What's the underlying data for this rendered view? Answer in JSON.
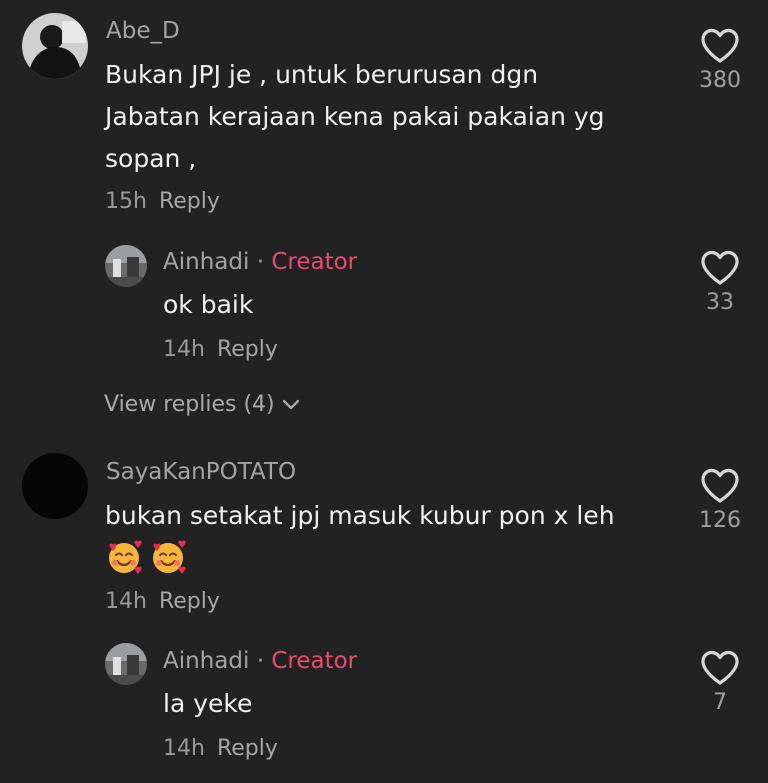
{
  "comments": [
    {
      "username": "Abe_D",
      "text_lines": [
        "Bukan JPJ je , untuk berurusan dgn",
        "Jabatan kerajaan kena pakai pakaian yg",
        "sopan ,"
      ],
      "time": "15h",
      "reply_label": "Reply",
      "likes": "380"
    },
    {
      "username": "Ainhadi",
      "badge": "Creator",
      "separator": "·",
      "text": "ok baik",
      "time": "14h",
      "reply_label": "Reply",
      "likes": "33"
    },
    {
      "username": "SayaKanPOTATO",
      "text": "bukan setakat jpj masuk kubur pon x leh",
      "emojis": [
        "smiling-face-with-hearts",
        "smiling-face-with-hearts"
      ],
      "time": "14h",
      "reply_label": "Reply",
      "likes": "126"
    },
    {
      "username": "Ainhadi",
      "badge": "Creator",
      "separator": "·",
      "text": "la yeke",
      "time": "14h",
      "reply_label": "Reply",
      "likes": "7"
    }
  ],
  "view_replies": "View replies (4)",
  "colors": {
    "background": "#222222",
    "text": "#f0f0f0",
    "muted": "#a4a4a4",
    "creator": "#ea4b6a"
  },
  "icons": {
    "like": "heart-outline-icon",
    "expand": "chevron-down-icon"
  }
}
